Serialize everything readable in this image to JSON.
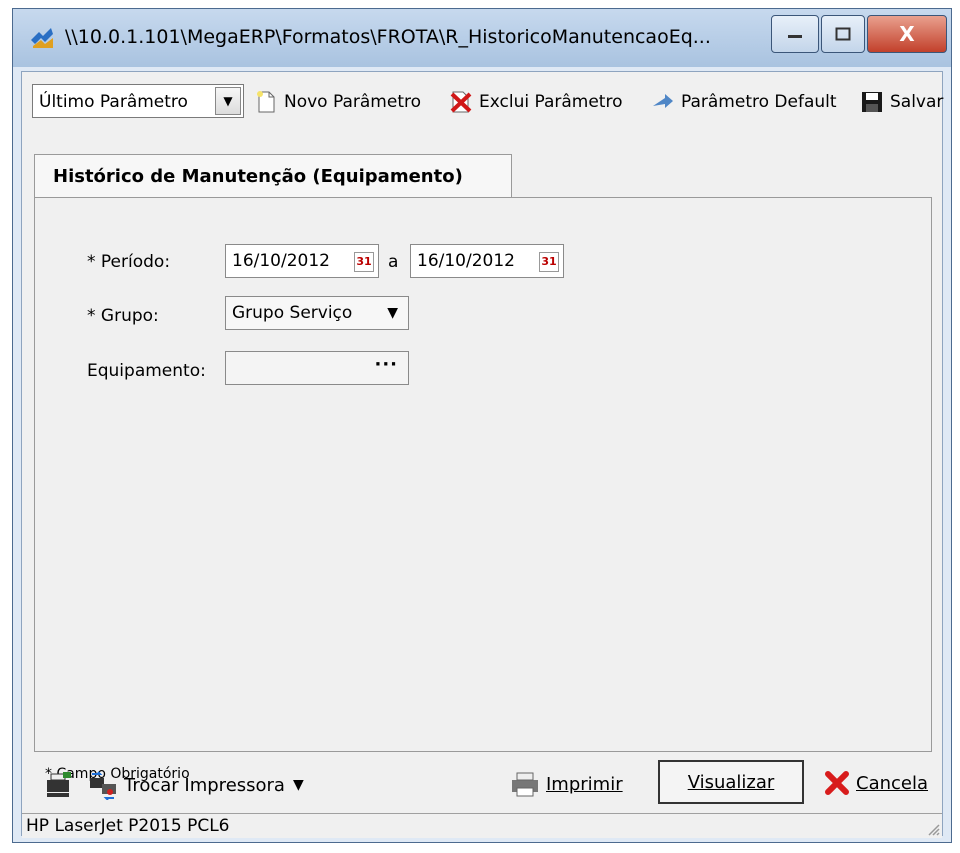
{
  "window": {
    "title": "\\\\10.0.1.101\\MegaERP\\Formatos\\FROTA\\R_HistoricoManutencaoEq...",
    "controls": {
      "close": "X"
    }
  },
  "toolbar": {
    "parameter_select": "Último Parâmetro",
    "new_parameter": "Novo Parâmetro",
    "delete_parameter": "Exclui Parâmetro",
    "default_parameter": "Parâmetro Default",
    "save": "Salvar"
  },
  "tabs": [
    {
      "label": "Histórico de Manutenção (Equipamento)"
    }
  ],
  "form": {
    "period_label": "* Período:",
    "period_from": "16/10/2012",
    "period_to_label": "a",
    "period_to": "16/10/2012",
    "group_label": "* Grupo:",
    "group_value": "Grupo Serviço",
    "equipment_label": "Equipamento:",
    "equipment_value": "",
    "required_note": "* Campo Obrigatório"
  },
  "actions": {
    "change_printer": "Trocar Impressora",
    "print": "Imprimir",
    "preview": "Visualizar",
    "cancel": "Cancela"
  },
  "status_bar": {
    "printer": "HP LaserJet P2015 PCL6"
  },
  "colors": {
    "title_bar": "#b8cfe8",
    "close_button": "#c2402b",
    "panel": "#f0f0f0"
  }
}
